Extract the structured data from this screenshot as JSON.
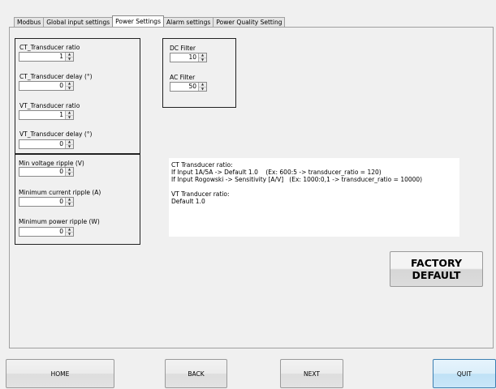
{
  "tabs": [
    {
      "label": "Modbus",
      "active": false
    },
    {
      "label": "Global input settings",
      "active": false
    },
    {
      "label": "Power Settings",
      "active": true
    },
    {
      "label": "Alarm settings",
      "active": false
    },
    {
      "label": "Power Quality Setting",
      "active": false
    }
  ],
  "transducer": {
    "ct_ratio_label": "CT_Transducer ratio",
    "ct_ratio_value": "1",
    "ct_delay_label": "CT_Transducer delay (°)",
    "ct_delay_value": "0",
    "vt_ratio_label": "VT_Transducer ratio",
    "vt_ratio_value": "1",
    "vt_delay_label": "VT_Transducer delay (°)",
    "vt_delay_value": "0"
  },
  "ripple": {
    "min_voltage_label": "Min voltage ripple (V)",
    "min_voltage_value": "0",
    "min_current_label": "Minimum current ripple (A)",
    "min_current_value": "0",
    "min_power_label": "Minimum power ripple (W)",
    "min_power_value": "0"
  },
  "filters": {
    "dc_label": "DC Filter",
    "dc_value": "10",
    "ac_label": "AC Filter",
    "ac_value": "50"
  },
  "info": {
    "line1": "CT Transducer ratio:",
    "line2": "If Input 1A/5A -> Default 1.0    (Ex: 600:5 -> transducer_ratio = 120)",
    "line3": "If Input Rogowski -> Sensitivity [A/V]   (Ex: 1000:0,1 -> transducer_ratio = 10000)",
    "line4": "",
    "line5": "VT Tranducer ratio:",
    "line6": "Default 1.0"
  },
  "factory_default": {
    "line1": "FACTORY",
    "line2": "DEFAULT"
  },
  "nav": {
    "home": "HOME",
    "back": "BACK",
    "next": "NEXT",
    "quit": "QUIT"
  },
  "icons": {
    "spin_up": "triangle-up",
    "spin_down": "triangle-down"
  }
}
